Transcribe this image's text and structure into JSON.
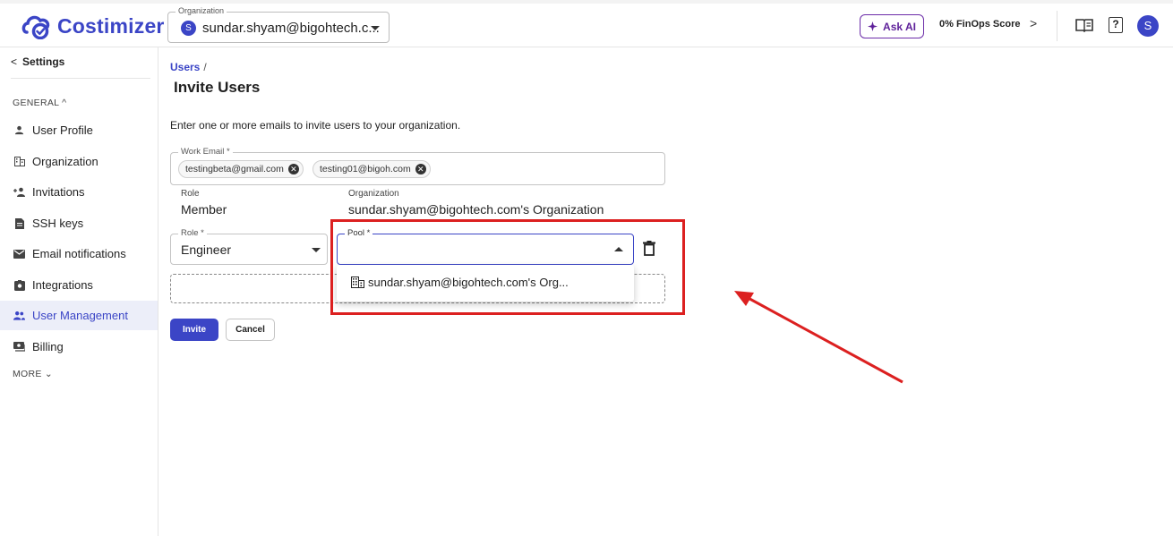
{
  "app": {
    "name": "Costimizer"
  },
  "header": {
    "org_label": "Organization",
    "org_avatar": "S",
    "org_value": "sundar.shyam@bigohtech.c...",
    "ask_ai": "Ask AI",
    "finops_score": "0% FinOps Score",
    "finops_chevron": ">",
    "help_glyph": "?",
    "user_avatar": "S",
    "accent_color": "#3b45c6"
  },
  "sidebar": {
    "back_chevron": "<",
    "back_label": "Settings",
    "general_label": "GENERAL ^",
    "more_label": "MORE ⌄",
    "items": [
      {
        "label": "User Profile",
        "icon": "person-icon",
        "active": false
      },
      {
        "label": "Organization",
        "icon": "building-icon",
        "active": false
      },
      {
        "label": "Invitations",
        "icon": "person-add-icon",
        "active": false
      },
      {
        "label": "SSH keys",
        "icon": "document-icon",
        "active": false
      },
      {
        "label": "Email notifications",
        "icon": "mail-icon",
        "active": false
      },
      {
        "label": "Integrations",
        "icon": "integration-icon",
        "active": false
      },
      {
        "label": "User Management",
        "icon": "people-icon",
        "active": true
      },
      {
        "label": "Billing",
        "icon": "billing-icon",
        "active": false
      }
    ]
  },
  "main": {
    "breadcrumb": "Users",
    "breadcrumb_sep": "/",
    "title": "Invite Users",
    "intro": "Enter one or more emails to invite users to your organization.",
    "work_email_label": "Work Email *",
    "emails": [
      "testingbeta@gmail.com",
      "testing01@bigoh.com"
    ],
    "chip_remove": "✕",
    "static_role_label": "Role",
    "static_role_value": "Member",
    "static_org_label": "Organization",
    "static_org_value": "sundar.shyam@bigohtech.com's Organization",
    "role_label": "Role *",
    "role_value": "Engineer",
    "pool_label": "Pool *",
    "pool_value": "",
    "pool_option": "sundar.shyam@bigohtech.com's Org...",
    "invite_button": "Invite",
    "cancel_button": "Cancel"
  },
  "annotation": {
    "highlight_color": "#dc2020"
  }
}
